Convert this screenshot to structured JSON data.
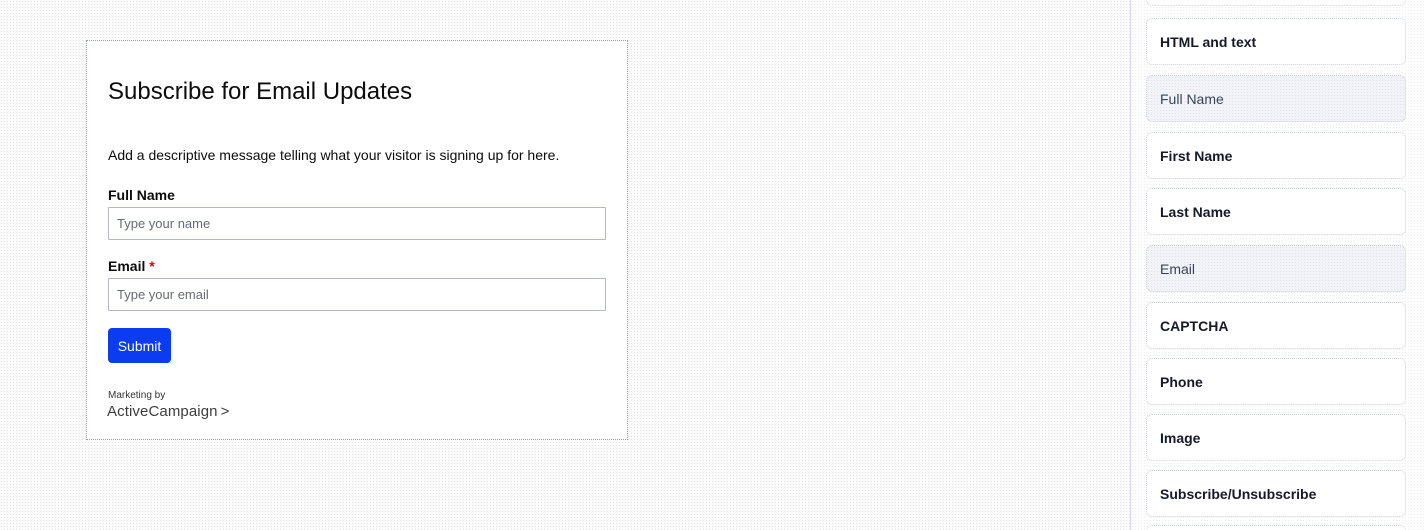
{
  "form": {
    "title": "Subscribe for Email Updates",
    "description": "Add a descriptive message telling what your visitor is signing up for here.",
    "fields": [
      {
        "label": "Full Name",
        "required": false,
        "placeholder": "Type your name"
      },
      {
        "label": "Email",
        "required": true,
        "required_mark": "*",
        "placeholder": "Type your email"
      }
    ],
    "submit_label": "Submit",
    "powered_by_text": "Marketing by",
    "powered_by_brand": "ActiveCampaign",
    "powered_by_chevron": ">"
  },
  "sidebar": {
    "items": [
      {
        "label": "HTML and text",
        "state": "available"
      },
      {
        "label": "Full Name",
        "state": "used"
      },
      {
        "label": "First Name",
        "state": "available"
      },
      {
        "label": "Last Name",
        "state": "available"
      },
      {
        "label": "Email",
        "state": "used"
      },
      {
        "label": "CAPTCHA",
        "state": "available"
      },
      {
        "label": "Phone",
        "state": "available"
      },
      {
        "label": "Image",
        "state": "available"
      },
      {
        "label": "Subscribe/Unsubscribe",
        "state": "available"
      }
    ]
  },
  "colors": {
    "submit_button": "#0b3cf2",
    "required_mark": "#d0021b"
  }
}
